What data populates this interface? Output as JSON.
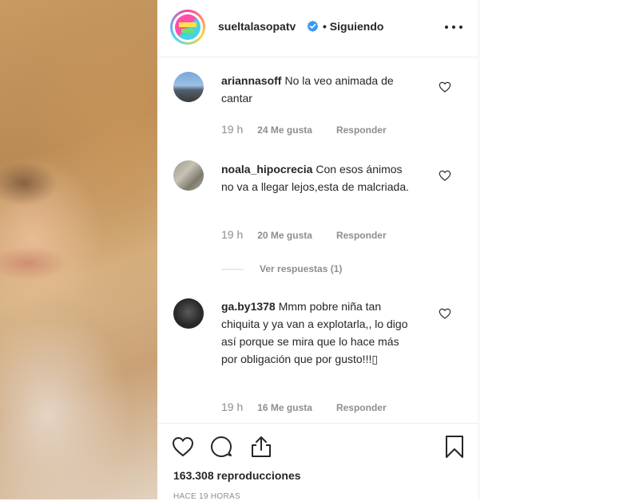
{
  "header": {
    "username": "sueltalasopatv",
    "following_label": "• Siguiendo",
    "avatar_text": "SUELTA LA SOPA"
  },
  "comments": [
    {
      "user": "ariannasoff",
      "text": "No la veo animada de cantar",
      "time": "19 h",
      "likes": "24 Me gusta",
      "reply": "Responder"
    },
    {
      "user": "noala_hipocrecia",
      "text": "Con esos ánimos no va a llegar lejos,esta de malcriada.",
      "time": "19 h",
      "likes": "20 Me gusta",
      "reply": "Responder",
      "view_replies": "Ver respuestas (1)"
    },
    {
      "user": "ga.by1378",
      "text": "Mmm pobre niña tan chiquita y ya van a explotarla,, lo digo así porque se mira que lo hace más por obligación que por gusto!!!▯",
      "time": "19 h",
      "likes": "16 Me gusta",
      "reply": "Responder"
    }
  ],
  "footer": {
    "views": "163.308 reproducciones",
    "ago": "HACE 19 HORAS"
  },
  "colors": {
    "text": "#262626",
    "muted": "#8e8e8e",
    "verified": "#3897f0"
  }
}
